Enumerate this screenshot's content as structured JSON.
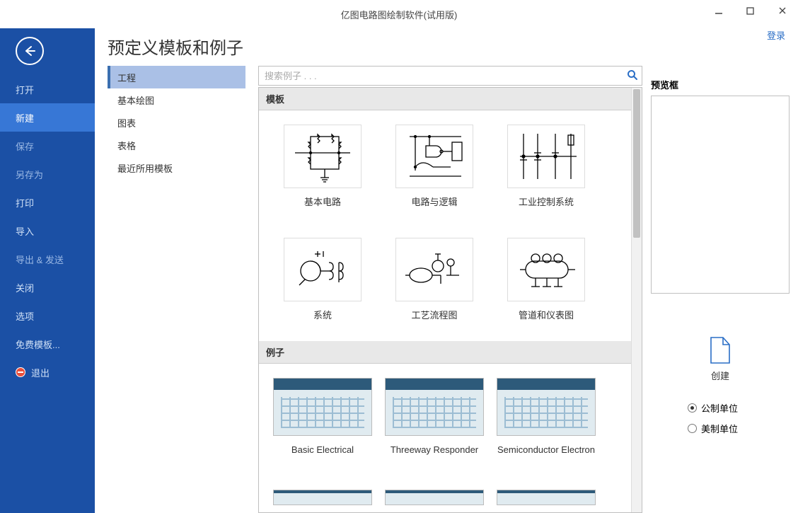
{
  "app_title": "亿图电路图绘制软件(试用版)",
  "login_text": "登录",
  "sidebar": {
    "items": [
      {
        "label": "打开",
        "key": "open"
      },
      {
        "label": "新建",
        "key": "new"
      },
      {
        "label": "保存",
        "key": "save"
      },
      {
        "label": "另存为",
        "key": "saveas"
      },
      {
        "label": "打印",
        "key": "print"
      },
      {
        "label": "导入",
        "key": "import"
      },
      {
        "label": "导出 & 发送",
        "key": "export"
      },
      {
        "label": "关闭",
        "key": "close"
      },
      {
        "label": "选项",
        "key": "options"
      },
      {
        "label": "免费模板...",
        "key": "free"
      },
      {
        "label": "退出",
        "key": "exit"
      }
    ],
    "active": "new",
    "dimmed": [
      "save",
      "saveas",
      "export"
    ]
  },
  "page_title": "预定义模板和例子",
  "search": {
    "placeholder": "搜索例子 . . ."
  },
  "categories": [
    {
      "label": "工程",
      "key": "eng",
      "selected": true
    },
    {
      "label": "基本绘图",
      "key": "basic"
    },
    {
      "label": "图表",
      "key": "chart"
    },
    {
      "label": "表格",
      "key": "table"
    },
    {
      "label": "最近所用模板",
      "key": "recent"
    }
  ],
  "section_templates": "模板",
  "section_examples": "例子",
  "templates": [
    {
      "label": "基本电路",
      "icon": "circuit-basic"
    },
    {
      "label": "电路与逻辑",
      "icon": "circuit-logic"
    },
    {
      "label": "工业控制系统",
      "icon": "industrial"
    },
    {
      "label": "系统",
      "icon": "system"
    },
    {
      "label": "工艺流程图",
      "icon": "process"
    },
    {
      "label": "管道和仪表图",
      "icon": "pid"
    }
  ],
  "examples": [
    {
      "label": "Basic Electrical"
    },
    {
      "label": "Threeway Responder"
    },
    {
      "label": "Semiconductor Electron"
    }
  ],
  "preview_label": "预览框",
  "create_label": "创建",
  "units": {
    "metric": "公制单位",
    "imperial": "美制单位",
    "selected": "metric"
  }
}
